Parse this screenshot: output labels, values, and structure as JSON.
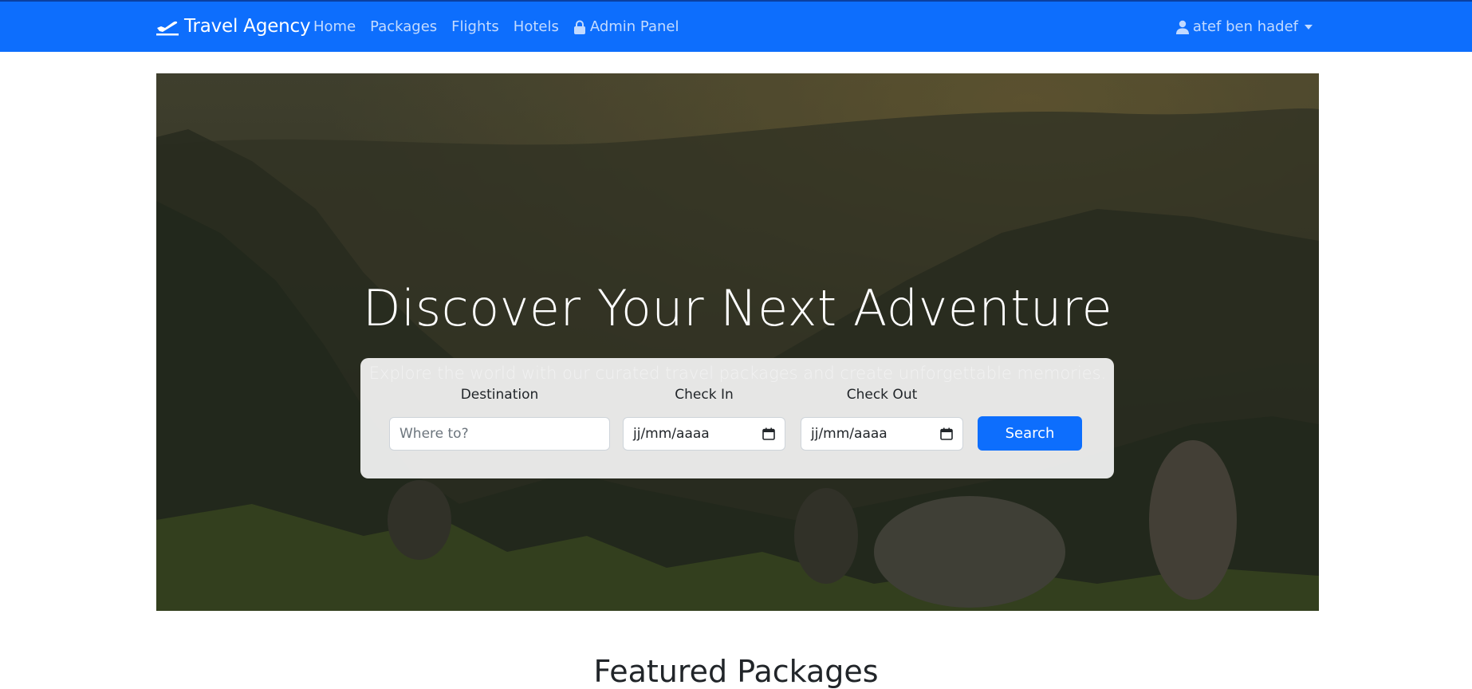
{
  "navbar": {
    "brand": "Travel Agency",
    "links": [
      {
        "label": "Home"
      },
      {
        "label": "Packages"
      },
      {
        "label": "Flights"
      },
      {
        "label": "Hotels"
      },
      {
        "label": "Admin Panel"
      }
    ],
    "user": "atef ben hadef"
  },
  "hero": {
    "title": "Discover Your Next Adventure",
    "subtitle": "Explore the world with our curated travel packages and create unforgettable memories."
  },
  "search": {
    "destination_label": "Destination",
    "destination_placeholder": "Where to?",
    "checkin_label": "Check In",
    "checkin_value": "jj/mm/aaaa",
    "checkout_label": "Check Out",
    "checkout_value": "jj/mm/aaaa",
    "button_label": "Search"
  },
  "featured": {
    "title": "Featured Packages"
  },
  "colors": {
    "primary": "#0d6efd",
    "text": "#212529"
  },
  "icons": [
    "plane-icon",
    "lock-icon",
    "user-icon",
    "calendar-icon",
    "caret-down-icon"
  ]
}
